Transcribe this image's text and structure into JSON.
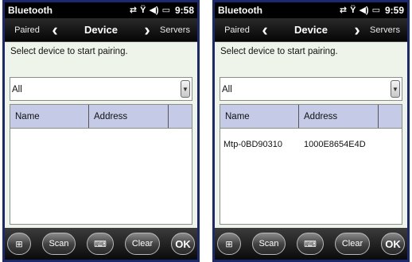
{
  "screens": [
    {
      "statusbar": {
        "title": "Bluetooth",
        "time": "9:58"
      },
      "navbar": {
        "left": "Paired",
        "title": "Device",
        "right": "Servers"
      },
      "prompt": "Select device to start pairing.",
      "filter": {
        "value": "All"
      },
      "columns": [
        "Name",
        "Address"
      ],
      "rows": [],
      "softkeys": {
        "scan": "Scan",
        "clear": "Clear",
        "ok": "OK"
      }
    },
    {
      "statusbar": {
        "title": "Bluetooth",
        "time": "9:59"
      },
      "navbar": {
        "left": "Paired",
        "title": "Device",
        "right": "Servers"
      },
      "prompt": "Select device to start pairing.",
      "filter": {
        "value": "All"
      },
      "columns": [
        "Name",
        "Address"
      ],
      "rows": [
        {
          "name": "Mtp-0BD90310",
          "address": "1000E8654E4D"
        }
      ],
      "softkeys": {
        "scan": "Scan",
        "clear": "Clear",
        "ok": "OK"
      }
    }
  ],
  "icons": {
    "sync": "sync-icon",
    "signal": "no-signal-icon",
    "volume": "volume-icon",
    "battery": "battery-icon",
    "windows": "windows-start-icon",
    "keyboard": "keyboard-icon",
    "nav_prev": "chevron-left-icon",
    "nav_next": "chevron-right-icon",
    "dropdown": "dropdown-arrow-icon"
  }
}
